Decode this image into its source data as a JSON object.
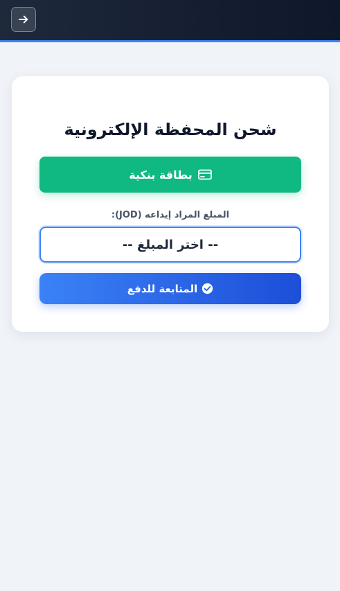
{
  "header": {
    "back_icon": "arrow-right-icon"
  },
  "card": {
    "title": "شحن المحفظة الإلكترونية",
    "bank_card_button": {
      "label": "بطاقة بنكية",
      "icon": "credit-card-icon"
    },
    "amount_label": "المبلغ المراد إيداعه (JOD):",
    "amount_select": {
      "selected": "-- اختر المبلغ --"
    },
    "continue_button": {
      "label": "المتابعة للدفع",
      "icon": "check-circle-icon"
    }
  },
  "colors": {
    "header_bg": "#0f172a",
    "header_accent": "#3b82f6",
    "bank_green": "#10b981",
    "primary_blue": "#2563eb",
    "page_bg": "#f0f4f9"
  }
}
